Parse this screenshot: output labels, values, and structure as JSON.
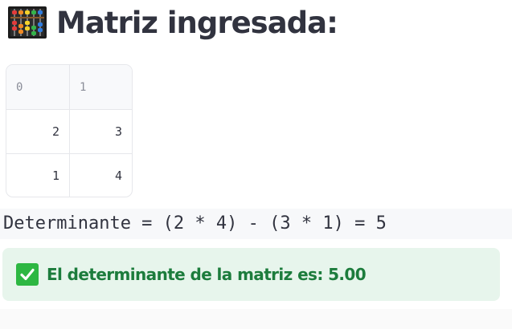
{
  "header": {
    "icon": "abacus-icon",
    "title": "Matriz ingresada:"
  },
  "matrix": {
    "columns": [
      "0",
      "1"
    ],
    "rows": [
      [
        "2",
        "3"
      ],
      [
        "1",
        "4"
      ]
    ]
  },
  "formula": "Determinante = (2 * 4) - (3 * 1) = 5",
  "result": {
    "icon": "check-mark-icon",
    "message": "El determinante de la matriz es: 5.00",
    "color": "#1c7c3c",
    "background": "#e7f5ec"
  }
}
